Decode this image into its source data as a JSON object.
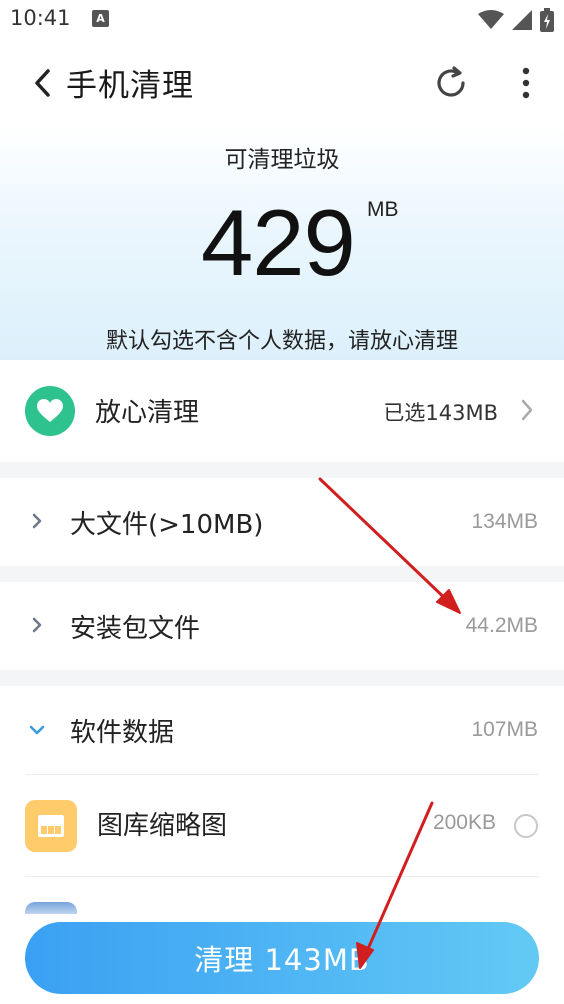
{
  "status_bar": {
    "time": "10:41",
    "notif_glyph": "A"
  },
  "header": {
    "title": "手机清理",
    "back_icon": "chevron-left-icon",
    "refresh_icon": "refresh-icon",
    "more_icon": "more-vertical-icon"
  },
  "hero": {
    "label": "可清理垃圾",
    "size": "429",
    "unit": "MB",
    "note": "默认勾选不含个人数据，请放心清理"
  },
  "safe_clean": {
    "label": "放心清理",
    "value": "已选143MB",
    "icon": "heart-icon",
    "color": "#2ec28e"
  },
  "categories": [
    {
      "label": "大文件(>10MB)",
      "size": "134MB",
      "expanded": false
    },
    {
      "label": "安装包文件",
      "size": "44.2MB",
      "expanded": false
    },
    {
      "label": "软件数据",
      "size": "107MB",
      "expanded": true
    }
  ],
  "sub_items": [
    {
      "label": "图库缩略图",
      "size": "200KB",
      "checked": false,
      "icon": "gallery-thumbnail-icon"
    }
  ],
  "clean_button": {
    "label": "清理 143MB"
  },
  "colors": {
    "accent": "#3aa0f3",
    "annotation_arrow": "#d11f1f"
  }
}
